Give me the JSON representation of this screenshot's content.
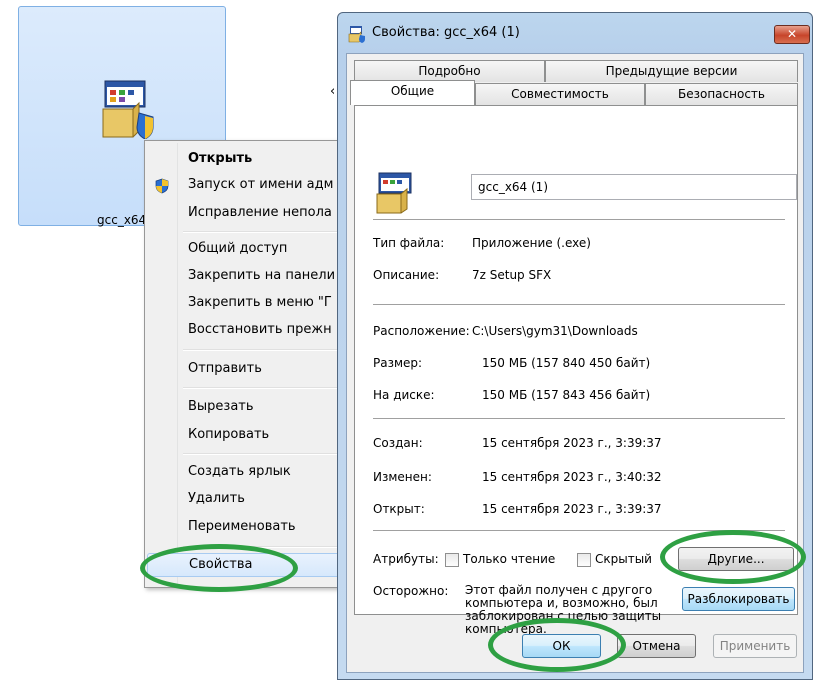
{
  "desktop": {
    "file_label": "gcc_x64"
  },
  "context_menu": {
    "items": [
      {
        "label": "Открыть"
      },
      {
        "label": "Запуск от имени адм"
      },
      {
        "label": "Исправление непола"
      },
      {
        "label": "Общий доступ"
      },
      {
        "label": "Закрепить на панели"
      },
      {
        "label": "Закрепить в меню \"Г"
      },
      {
        "label": "Восстановить прежн"
      },
      {
        "label": "Отправить"
      },
      {
        "label": "Вырезать"
      },
      {
        "label": "Копировать"
      },
      {
        "label": "Создать ярлык"
      },
      {
        "label": "Удалить"
      },
      {
        "label": "Переименовать"
      },
      {
        "label": "Свойства"
      }
    ]
  },
  "window": {
    "title": "Свойства: gcc_x64 (1)",
    "close_glyph": "✕",
    "tabs_top": [
      {
        "label": "Подробно"
      },
      {
        "label": "Предыдущие версии"
      }
    ],
    "tabs_bottom": [
      {
        "label": "Общие"
      },
      {
        "label": "Совместимость"
      },
      {
        "label": "Безопасность"
      }
    ],
    "filename": "gcc_x64 (1)",
    "file_type_label": "Тип файла:",
    "file_type_value": "Приложение (.exe)",
    "description_label": "Описание:",
    "description_value": "7z Setup SFX",
    "location_label": "Расположение:",
    "location_value": "C:\\Users\\gym31\\Downloads",
    "size_label": "Размер:",
    "size_value": "150 МБ (157 840 450 байт)",
    "disk_label": "На диске:",
    "disk_value": "150 МБ (157 843 456 байт)",
    "created_label": "Создан:",
    "created_value": "15 сентября 2023 г., 3:39:37",
    "modified_label": "Изменен:",
    "modified_value": "15 сентября 2023 г., 3:40:32",
    "opened_label": "Открыт:",
    "opened_value": "15 сентября 2023 г., 3:39:37",
    "attributes_label": "Атрибуты:",
    "readonly_label": "Только чтение",
    "hidden_label": "Скрытый",
    "other_button": "Другие...",
    "caution_label": "Осторожно:",
    "caution_text": "Этот файл получен с другого компьютера и, возможно, был заблокирован с целью защиты компьютера.",
    "unblock_button": "Разблокировать",
    "ok_button": "ОК",
    "cancel_button": "Отмена",
    "apply_button": "Применить"
  },
  "colors": {
    "highlight_ellipse": "#2ea043",
    "title_gradient": "#bcd6ee",
    "close_button": "#c7452b"
  }
}
